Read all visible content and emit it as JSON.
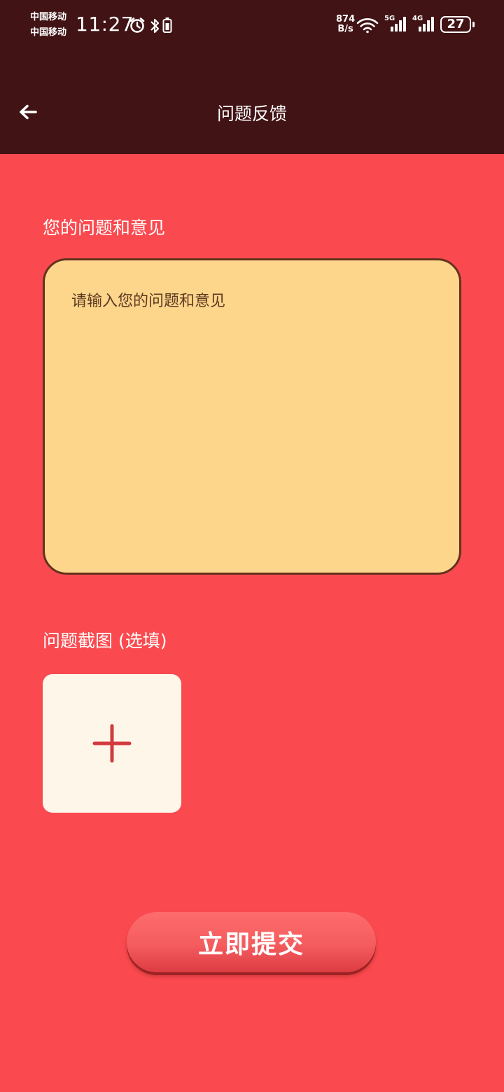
{
  "status_bar": {
    "carrier_1": "中国移动",
    "carrier_2": "中国移动",
    "time": "11:27",
    "net_speed_value": "874",
    "net_speed_unit": "B/s",
    "signal_1_label": "5G",
    "signal_2_label": "4G",
    "battery": "27",
    "icons": [
      "alarm-icon",
      "bluetooth-icon",
      "battery-saver-icon",
      "wifi-icon",
      "signal-icon",
      "battery-icon"
    ]
  },
  "header": {
    "title": "问题反馈",
    "back_icon": "arrow-left-icon"
  },
  "form": {
    "feedback_label": "您的问题和意见",
    "feedback_placeholder": "请输入您的问题和意见",
    "feedback_value": "",
    "screenshot_label": "问题截图 (选填)",
    "upload_icon": "plus-icon",
    "submit_label": "立即提交"
  },
  "colors": {
    "background": "#fa4a4f",
    "header": "#411315",
    "textarea_bg": "#fdd58b",
    "textarea_border": "#63321e",
    "upload_bg": "#fff6ea",
    "plus": "#d23a3f",
    "submit": "#f45c5e"
  }
}
